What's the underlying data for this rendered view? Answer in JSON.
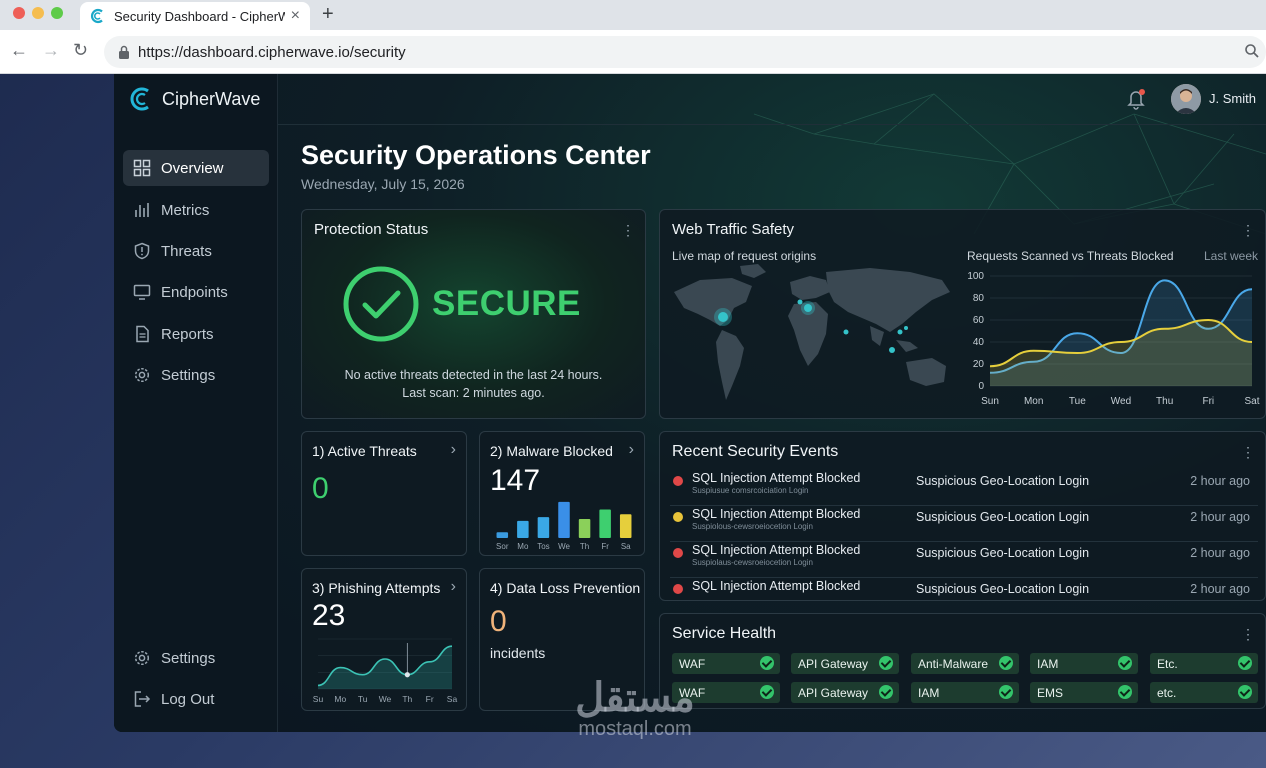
{
  "browser": {
    "tab_title": "Security Dashboard - CipherWave",
    "url": "https://dashboard.cipherwave.io/security"
  },
  "app": {
    "brand": "CipherWave",
    "user_name": "J. Smith"
  },
  "sidebar": {
    "items": [
      {
        "label": "Overview",
        "icon": "grid-icon",
        "active": true
      },
      {
        "label": "Metrics",
        "icon": "bar-chart-icon"
      },
      {
        "label": "Threats",
        "icon": "shield-icon"
      },
      {
        "label": "Endpoints",
        "icon": "monitor-icon"
      },
      {
        "label": "Reports",
        "icon": "document-icon"
      },
      {
        "label": "Settings",
        "icon": "gear-icon"
      }
    ],
    "bottom": [
      {
        "label": "Settings",
        "icon": "gear-icon"
      },
      {
        "label": "Log Out",
        "icon": "logout-icon"
      }
    ]
  },
  "page": {
    "title": "Security Operations Center",
    "date": "Wednesday, July 15, 2026"
  },
  "protection": {
    "title": "Protection Status",
    "status": "SECURE",
    "message_line1": "No active threats detected in the last 24 hours.",
    "message_line2": "Last scan: 2 minutes ago."
  },
  "traffic": {
    "title": "Web Traffic Safety",
    "map_label": "Live map of request origins",
    "chart_title": "Requests Scanned vs Threats Blocked",
    "period": "Last week"
  },
  "metrics": {
    "active_threats": {
      "title": "1) Active Threats",
      "value": "0"
    },
    "malware_blocked": {
      "title": "2) Malware Blocked",
      "value": "147"
    },
    "phishing": {
      "title": "3) Phishing Attempts",
      "value": "23"
    },
    "dlp": {
      "title": "4) Data Loss Prevention",
      "value": "0",
      "unit": "incidents"
    }
  },
  "events": {
    "title": "Recent Security Events",
    "rows": [
      {
        "title": "SQL Injection Attempt Blocked",
        "sub": "Suspiusue comsrcoiciation Login",
        "geo": "Suspicious Geo-Location Login",
        "time": "2 hour ago",
        "severity": "#e04848"
      },
      {
        "title": "SQL Injection Attempt Blocked",
        "sub": "Suspiolous-cewsroeiocetion Login",
        "geo": "Suspicious Geo-Location Login",
        "time": "2 hour ago",
        "severity": "#e8c33a"
      },
      {
        "title": "SQL Injection Attempt Blocked",
        "sub": "Suspiolaus-cewsroeiocetion Login",
        "geo": "Suspicious Geo-Location Login",
        "time": "2 hour ago",
        "severity": "#e04848"
      },
      {
        "title": "SQL Injection Attempt Blocked",
        "sub": "",
        "geo": "Suspicious Geo-Location Login",
        "time": "2 hour ago",
        "severity": "#e04848"
      }
    ]
  },
  "service_health": {
    "title": "Service Health",
    "row1": [
      "WAF",
      "API Gateway",
      "Anti-Malware",
      "IAM",
      "Etc."
    ],
    "row2": [
      "WAF",
      "API Gateway",
      "IAM",
      "EMS",
      "etc."
    ]
  },
  "watermark": {
    "arabic": "مستقل",
    "latin": "mostaql.com"
  },
  "colors": {
    "accent_green": "#3ecf6f",
    "danger": "#e04848",
    "warning": "#e8c33a",
    "dlp_orange": "#f0b37a"
  },
  "chart_data": [
    {
      "type": "line",
      "title": "Requests Scanned vs Threats Blocked",
      "categories": [
        "Sun",
        "Mon",
        "Tue",
        "Wed",
        "Thu",
        "Fri",
        "Sat"
      ],
      "ylim": [
        0,
        100
      ],
      "yticks": [
        0,
        20,
        40,
        60,
        80,
        100
      ],
      "series": [
        {
          "values": [
            12,
            22,
            48,
            30,
            96,
            52,
            88
          ],
          "color": "#4aa8e8"
        },
        {
          "values": [
            18,
            32,
            30,
            40,
            52,
            60,
            40
          ],
          "color": "#e6cf3c"
        }
      ]
    },
    {
      "type": "bar",
      "categories": [
        "Sor",
        "Mo",
        "Tos",
        "We",
        "Th",
        "Fr",
        "Sa"
      ],
      "values": [
        6,
        18,
        22,
        38,
        20,
        30,
        25
      ],
      "ylim": [
        0,
        40
      ]
    },
    {
      "type": "area",
      "categories": [
        "Su",
        "Mo",
        "Tu",
        "We",
        "Th",
        "Fr",
        "Sa"
      ],
      "values": [
        5,
        30,
        20,
        42,
        20,
        38,
        60
      ],
      "ylim": [
        0,
        70
      ]
    }
  ]
}
